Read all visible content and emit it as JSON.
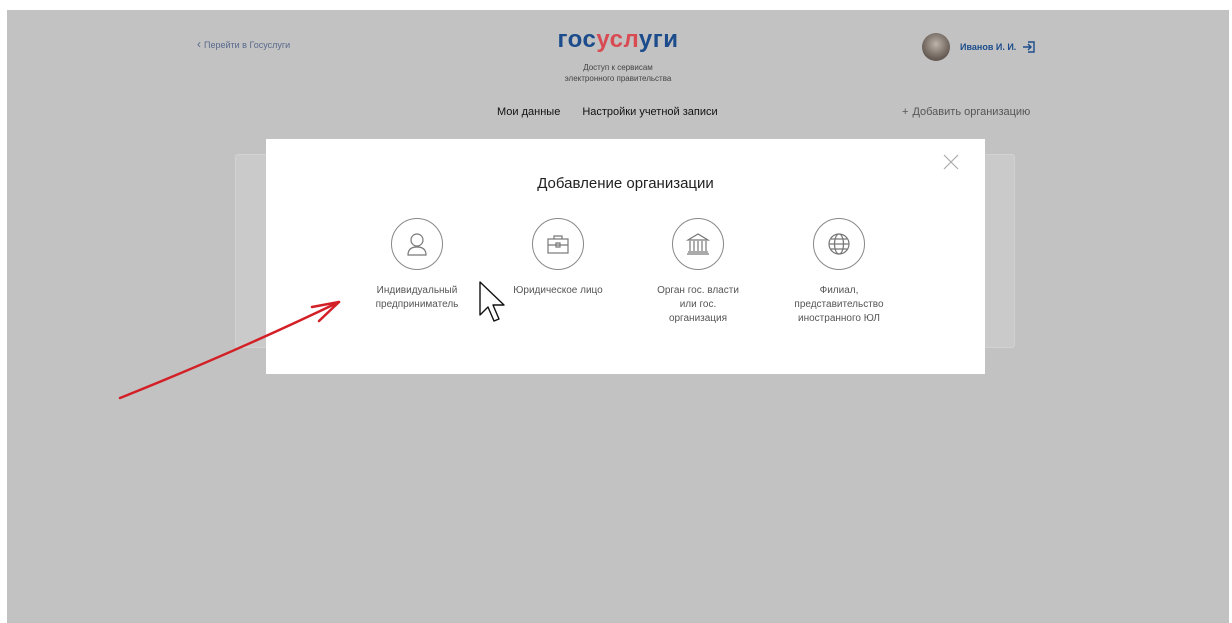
{
  "header": {
    "back_link": "Перейти в Госуслуги",
    "logo": {
      "part1": "гос",
      "part2": "усл",
      "part3": "уги"
    },
    "tagline_line1": "Доступ к сервисам",
    "tagline_line2": "электронного правительства",
    "user_name": "Иванов  И. И.",
    "nav": [
      "Мои данные",
      "Настройки учетной записи"
    ],
    "add_org_plus": "+",
    "add_org": "Добавить организацию"
  },
  "modal": {
    "title": "Добавление организации",
    "options": [
      {
        "line1": "Индивидуальный",
        "line2": "предприниматель",
        "line3": "",
        "icon": "person-icon"
      },
      {
        "line1": "Юридическое лицо",
        "line2": "",
        "line3": "",
        "icon": "briefcase-icon"
      },
      {
        "line1": "Орган гос. власти",
        "line2": "или гос.",
        "line3": "организация",
        "icon": "government-building-icon"
      },
      {
        "line1": "Филиал,",
        "line2": "представительство",
        "line3": "иностранного ЮЛ",
        "icon": "globe-icon"
      }
    ]
  },
  "colors": {
    "brand_blue": "#1c4c8c",
    "brand_red": "#d84b53",
    "overlay_gray": "#c2c2c2",
    "arrow_red": "#d32027"
  }
}
